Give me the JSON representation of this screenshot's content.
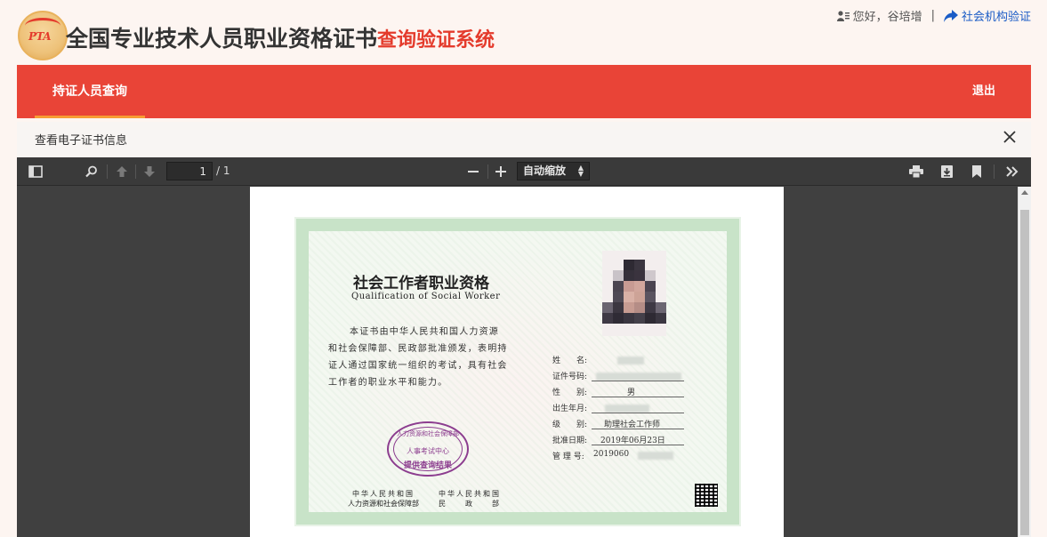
{
  "header": {
    "logo_text": "PTA",
    "title_main": "全国专业技术人员职业资格证书",
    "title_sub": "查询验证系统",
    "greeting": "您好，谷培增",
    "separator": "|",
    "org_link": "社会机构验证"
  },
  "nav": {
    "active_item": "持证人员查询",
    "logout": "退出"
  },
  "panel": {
    "title": "查看电子证书信息"
  },
  "pdf_toolbar": {
    "page_current": "1",
    "page_total": "/ 1",
    "zoom": "自动缩放"
  },
  "certificate": {
    "title": "社会工作者职业资格",
    "subtitle": "Qualification of Social Worker",
    "body": "本证书由中华人民共和国人力资源和社会保障部、民政部批准颁发，表明持证人通过国家统一组织的考试，具有社会工作者的职业水平和能力。",
    "fields": [
      {
        "label": "姓　　名:",
        "value": ""
      },
      {
        "label": "证件号码:",
        "value": ""
      },
      {
        "label": "性　　别:",
        "value": "男"
      },
      {
        "label": "出生年月:",
        "value": ""
      },
      {
        "label": "级　　别:",
        "value": "助理社会工作师"
      },
      {
        "label": "批准日期:",
        "value": "2019年06月23日"
      },
      {
        "label": "管 理 号:",
        "value": "2019060"
      }
    ],
    "seal_top": "人力资源和社会保障部",
    "seal_mid": "人事考试中心",
    "seal_bottom": "提供查询结果",
    "issuer_left_1": "中华人民共和国",
    "issuer_left_2": "人力资源和社会保障部",
    "issuer_right_1": "中华人民共和国",
    "issuer_right_2": "民　　政　　部"
  },
  "colors": {
    "nav_red": "#e94437",
    "title_red": "#e43b2c",
    "active_underline": "#f79c33",
    "link_blue": "#1a5cc6",
    "seal_purple": "#8c3d8f"
  }
}
